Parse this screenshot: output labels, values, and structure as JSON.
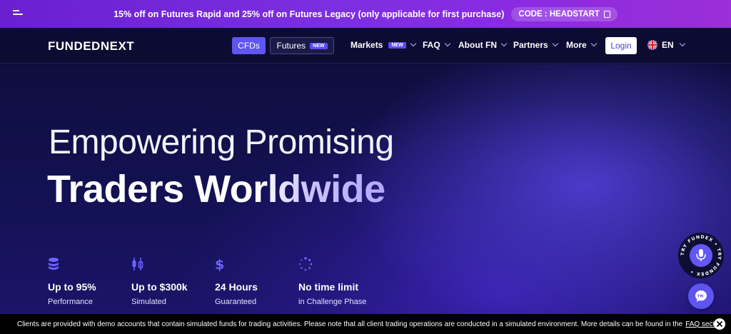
{
  "promo": {
    "text": "15% off on Futures Rapid and 25% off on Futures Legacy (only applicable for first purchase)",
    "code": "CODE : HEADSTART"
  },
  "nav": {
    "logo": "FUNDEDNEXT",
    "cfds": "CFDs",
    "futures": "Futures",
    "futures_badge": "NEW",
    "markets": "Markets",
    "markets_badge": "NEW",
    "faq": "FAQ",
    "about": "About FN",
    "partners": "Partners",
    "more": "More",
    "login": "Login",
    "lang": "EN"
  },
  "hero": {
    "line1": "Empowering Promising",
    "line2": "Traders Worldwide"
  },
  "features": [
    {
      "icon": "coins-icon",
      "title": "Up to 95%",
      "sub": "Performance"
    },
    {
      "icon": "candlestick-icon",
      "title": "Up to $300k",
      "sub": "Simulated"
    },
    {
      "icon": "dollar-icon",
      "title": "24 Hours",
      "sub": "Guaranteed"
    },
    {
      "icon": "loading-icon",
      "title": "No time limit",
      "sub": "in Challenge Phase"
    }
  ],
  "badge": {
    "ring_text": "TRY FUNDEX • TRY FUNDEX •"
  },
  "disclaimer": {
    "text": "Clients are provided with demo accounts that contain simulated funds for trading activities. Please note that all client trading operations are conducted in a simulated environment. More details can be found in the",
    "link": "FAQ section"
  },
  "colors": {
    "accent": "#5f55f0",
    "promo_bg": "#7b2fe0",
    "nav_bg": "#0c0c33",
    "disclaimer_bg": "#000000"
  }
}
